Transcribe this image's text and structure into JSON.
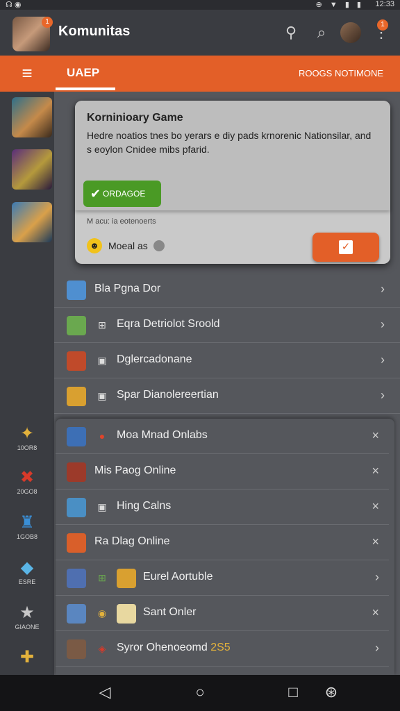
{
  "statusbar": {
    "time": "12:33",
    "icons": "⊕ ▼ ▮ ▮"
  },
  "header": {
    "title": "Komunitas",
    "badge": "1",
    "notify_badge": "1"
  },
  "tabs": {
    "tab1": "UAEP",
    "tab2": "ROOGS NOTIMONE"
  },
  "sidebar": {
    "items": [
      {
        "label": "10OR8",
        "icon": "puzzle-icon",
        "color": "#e3b23c"
      },
      {
        "label": "20GO8",
        "icon": "swords-icon",
        "color": "#d73a2a"
      },
      {
        "label": "1GOB8",
        "icon": "castle-icon",
        "color": "#3a8fd6"
      },
      {
        "label": "ESRE",
        "icon": "crystal-icon",
        "color": "#5ab5e6"
      },
      {
        "label": "GIAONE",
        "icon": "star-icon",
        "color": "#c8c8c8"
      }
    ]
  },
  "popup": {
    "title": "Korninioary Game",
    "text": "Hedre noatios tnes bo yerars e diy pads krnorenic Nationsilar, and s eoylon Cnidee mibs pfarid.",
    "ok_label": "ORDAGOE",
    "meta": "M acu: ia eotenoerts",
    "footer_label": "Moeal as"
  },
  "list1": [
    {
      "label": "Bla Pgna Dor",
      "trail": "›",
      "thumb": "#4f8fd0"
    },
    {
      "label": "Eqra Detriolot Sroold",
      "trail": "›",
      "thumb": "#6aa84f"
    },
    {
      "label": "Dglercadonane",
      "trail": "›",
      "thumb": "#c04a2a"
    },
    {
      "label": "Spar Dianolereertian",
      "trail": "›",
      "thumb": "#d9a030"
    }
  ],
  "list2": [
    {
      "label": "Moa Mnad Onlabs",
      "trail": "×",
      "thumb": "#3d6fb5"
    },
    {
      "label": "Mis Paog Online",
      "trail": "×",
      "thumb": "#9c3a2a"
    },
    {
      "label": "Hing Calns",
      "trail": "×",
      "thumb": "#4a8fc4"
    },
    {
      "label": "Ra Dlag Online",
      "trail": "×",
      "thumb": "#d95f2a"
    },
    {
      "label": "Eurel Aortuble",
      "trail": "›",
      "thumb": "#4f6fb0"
    },
    {
      "label": "Sant Onler",
      "trail": "×",
      "thumb": "#5a86c0"
    },
    {
      "label": "Syror Ohenoeomd",
      "badge": "2S5",
      "trail": "›",
      "thumb": "#7a5a45"
    }
  ]
}
